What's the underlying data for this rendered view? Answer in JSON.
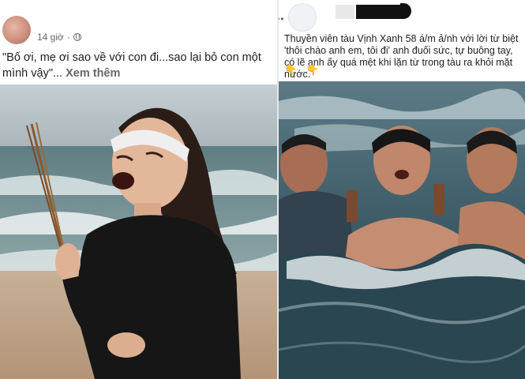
{
  "left_post": {
    "time": "14 giờ",
    "caption": "\"Bố ơi, mẹ ơi sao về với con đi...sao lại bỏ con một mình vậy\"...",
    "see_more": "Xem thêm",
    "icons": {
      "privacy": "globe-icon"
    },
    "colors": {
      "sky": "#b7c2c7",
      "sea": "#6f8c91",
      "sand": "#bfa58b",
      "shirt": "#151515"
    }
  },
  "right_post": {
    "caption": "Thuyền viên tàu Vịnh Xanh 58 á/m ả/nh với lời từ biệt 'thôi chào anh em, tôi đi' anh đuối sức, tự buông tay, có lẽ anh ấy quá mệt khi lặn từ trong tàu ra khỏi mặt nước.",
    "reaction_emoji": "👇 👇",
    "icons": {
      "menu": "more-dots-icon"
    },
    "colors": {
      "water": "#2f4b55",
      "foam": "#d9e4e6",
      "skin": "#b8826a"
    }
  }
}
